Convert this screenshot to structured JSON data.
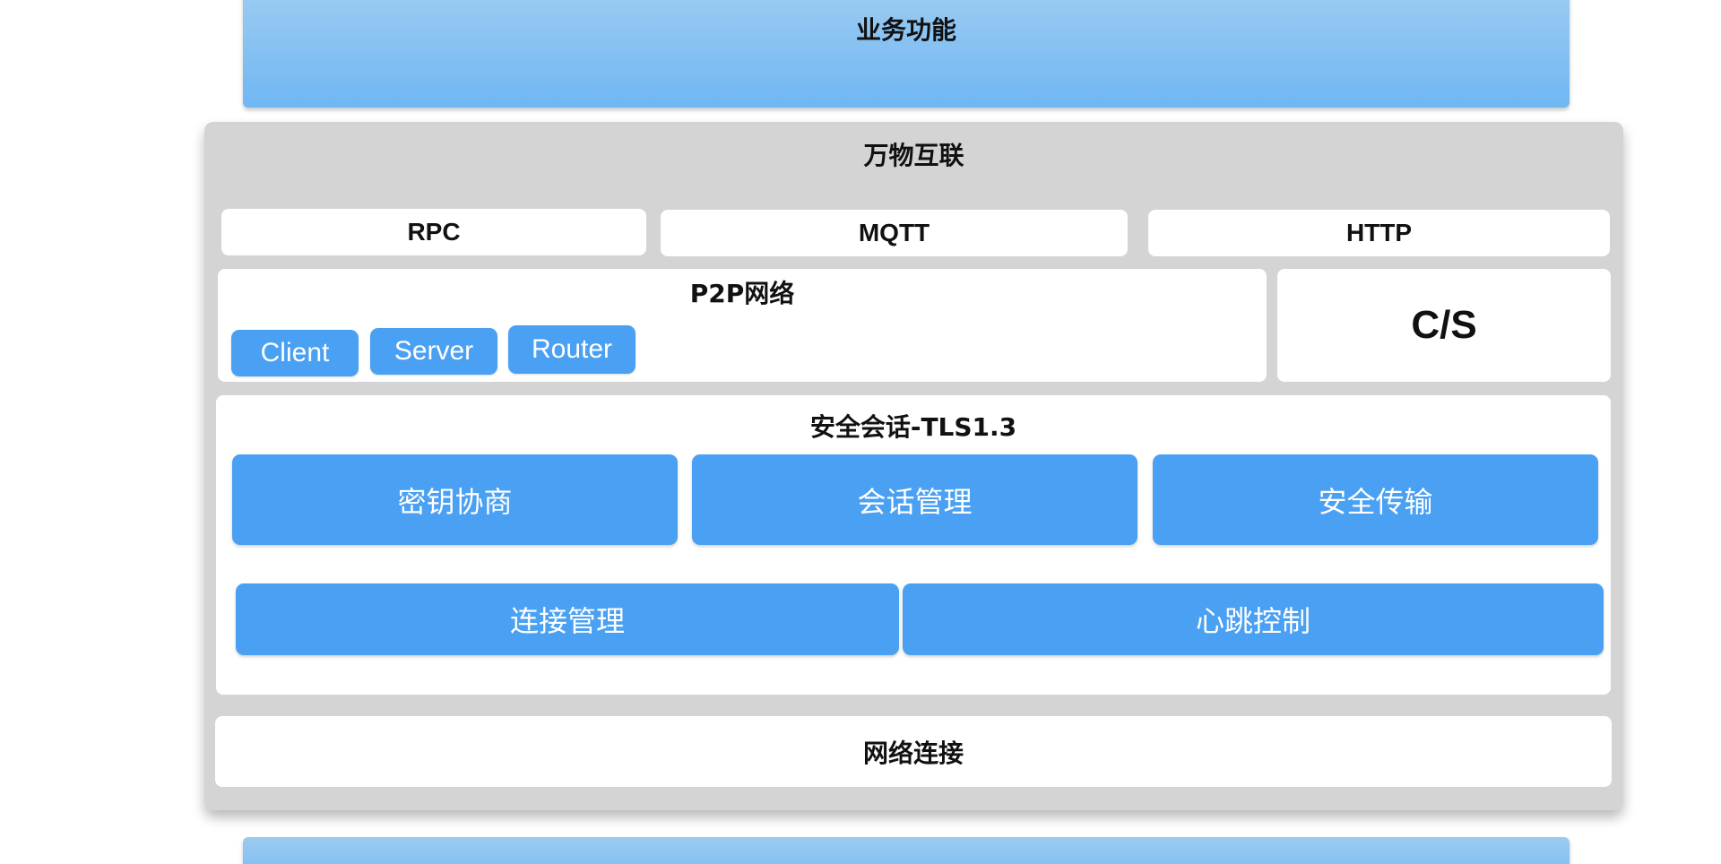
{
  "top_band": {
    "label": "业务功能"
  },
  "panel": {
    "title": "万物互联",
    "protocols": [
      {
        "label": "RPC"
      },
      {
        "label": "MQTT"
      },
      {
        "label": "HTTP"
      }
    ],
    "p2p": {
      "title": "P2P网络",
      "roles": [
        {
          "label": "Client"
        },
        {
          "label": "Server"
        },
        {
          "label": "Router"
        }
      ]
    },
    "cs": {
      "label": "C/S"
    },
    "tls": {
      "title": "安全会话-TLS1.3",
      "row1": [
        {
          "label": "密钥协商"
        },
        {
          "label": "会话管理"
        },
        {
          "label": "安全传输"
        }
      ],
      "row2": [
        {
          "label": "连接管理"
        },
        {
          "label": "心跳控制"
        }
      ]
    },
    "network": {
      "label": "网络连接"
    }
  },
  "colors": {
    "accent_blue": "#4aa0f2",
    "band_blue": "#7fbdf2",
    "panel_gray": "#d4d4d4"
  }
}
